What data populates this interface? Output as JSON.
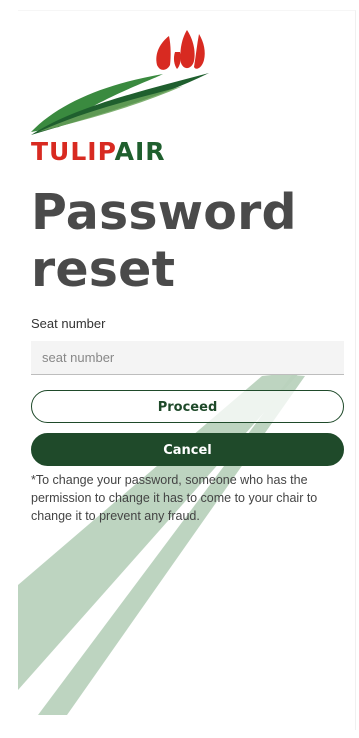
{
  "brand": {
    "name_part1": "TULIP",
    "name_part2": "AIR",
    "colors": {
      "red": "#d82a21",
      "green": "#1f5f2e",
      "dark_green": "#1f4a2a",
      "stripe_green": "#b9d2bd"
    },
    "logo_icon": "tulip-icon"
  },
  "title": "Password reset",
  "form": {
    "seat_label": "Seat number",
    "seat_placeholder": "seat number",
    "seat_value": ""
  },
  "buttons": {
    "proceed_label": "Proceed",
    "cancel_label": "Cancel"
  },
  "note": "*To change your password, someone who has the permission to change it has to come to your chair to change it to prevent any fraud."
}
